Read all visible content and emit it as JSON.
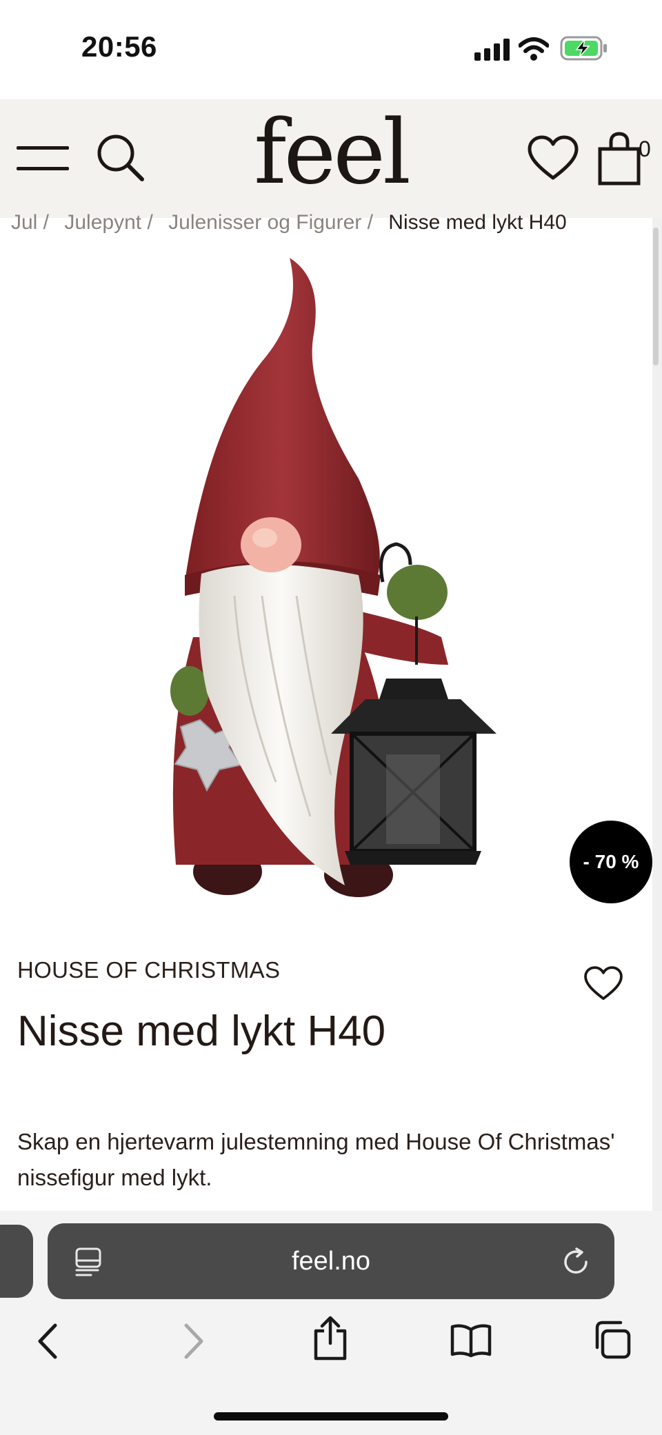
{
  "status_bar": {
    "time": "20:56",
    "icons": [
      "signal-icon",
      "wifi-icon",
      "battery-charging-icon"
    ]
  },
  "header": {
    "logo": "feel",
    "icons": [
      "menu-icon",
      "search-icon",
      "heart-icon",
      "cart-icon"
    ],
    "cart_count": "0"
  },
  "breadcrumb": {
    "items": [
      "Jul /",
      "Julepynt /",
      "Julenisser og Figurer /",
      "Nisse med lykt H40"
    ]
  },
  "product": {
    "image_alt": "Nisse med lykt",
    "discount_badge": "- 70 %",
    "brand": "HOUSE OF CHRISTMAS",
    "title": "Nisse med lykt H40",
    "description": "Skap en hjertevarm julestemning med House Of Christmas' nissefigur med lykt."
  },
  "browser": {
    "url": "feel.no",
    "icons": [
      "reader-icon",
      "reload-icon",
      "back-icon",
      "forward-icon",
      "share-icon",
      "bookmarks-icon",
      "tabs-icon"
    ]
  },
  "colors": {
    "header_bg": "#f4f2ee",
    "badge_bg": "#000000",
    "text": "#2a1f1a",
    "url_bar_bg": "#4a4a4a",
    "battery_green": "#4cd964"
  }
}
